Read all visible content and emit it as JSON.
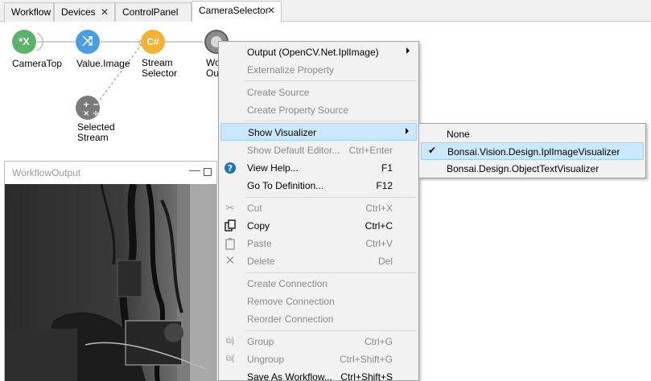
{
  "tabs": [
    {
      "label": "Workflow",
      "closable": false,
      "active": false
    },
    {
      "label": "Devices",
      "closable": true,
      "active": false
    },
    {
      "label": "ControlPanel",
      "closable": false,
      "active": false
    },
    {
      "label": "CameraSelector",
      "closable": true,
      "active": true
    }
  ],
  "nodes": {
    "camera_top": {
      "symbol": "*X",
      "label": "CameraTop",
      "color": "#5bb36a"
    },
    "value_image": {
      "symbol": "⤨",
      "label": "Value.Image",
      "color": "#4a9de0"
    },
    "stream_selector": {
      "symbol": "C#",
      "label_line1": "Stream",
      "label_line2": "Selector",
      "color": "#f2b233"
    },
    "workflow_output": {
      "label_line1": "Wo",
      "label_line2": "Ou",
      "color": "#8a8a8a"
    },
    "selected_stream": {
      "label_line1": "Selected",
      "label_line2": "Stream",
      "color": "#7a7a7a"
    }
  },
  "output_window": {
    "title": "WorkflowOutput"
  },
  "menu": {
    "output": {
      "label": "Output (OpenCV.Net.IplImage)"
    },
    "externalize": {
      "label": "Externalize Property"
    },
    "create_source": {
      "label": "Create Source"
    },
    "create_property_source": {
      "label": "Create Property Source"
    },
    "show_visualizer": {
      "label": "Show Visualizer"
    },
    "show_default_editor": {
      "label": "Show Default Editor...",
      "shortcut": "Ctrl+Enter"
    },
    "view_help": {
      "label": "View Help...",
      "shortcut": "F1"
    },
    "go_to_definition": {
      "label": "Go To Definition...",
      "shortcut": "F12"
    },
    "cut": {
      "label": "Cut",
      "shortcut": "Ctrl+X"
    },
    "copy": {
      "label": "Copy",
      "shortcut": "Ctrl+C"
    },
    "paste": {
      "label": "Paste",
      "shortcut": "Ctrl+V"
    },
    "delete": {
      "label": "Delete",
      "shortcut": "Del"
    },
    "create_connection": {
      "label": "Create Connection"
    },
    "remove_connection": {
      "label": "Remove Connection"
    },
    "reorder_connection": {
      "label": "Reorder Connection"
    },
    "group": {
      "label": "Group",
      "shortcut": "Ctrl+G"
    },
    "ungroup": {
      "label": "Ungroup",
      "shortcut": "Ctrl+Shift+G"
    },
    "save_as_workflow": {
      "label": "Save As Workflow...",
      "shortcut": "Ctrl+Shift+S"
    }
  },
  "submenu": {
    "none": {
      "label": "None"
    },
    "ipl_visualizer": {
      "label": "Bonsai.Vision.Design.IplImageVisualizer",
      "checked": true
    },
    "object_text_visualizer": {
      "label": "Bonsai.Design.ObjectTextVisualizer"
    }
  },
  "colors": {
    "highlight": "#cce8ff",
    "highlight_border": "#99d1ff",
    "help_icon": "#1c75bc"
  }
}
